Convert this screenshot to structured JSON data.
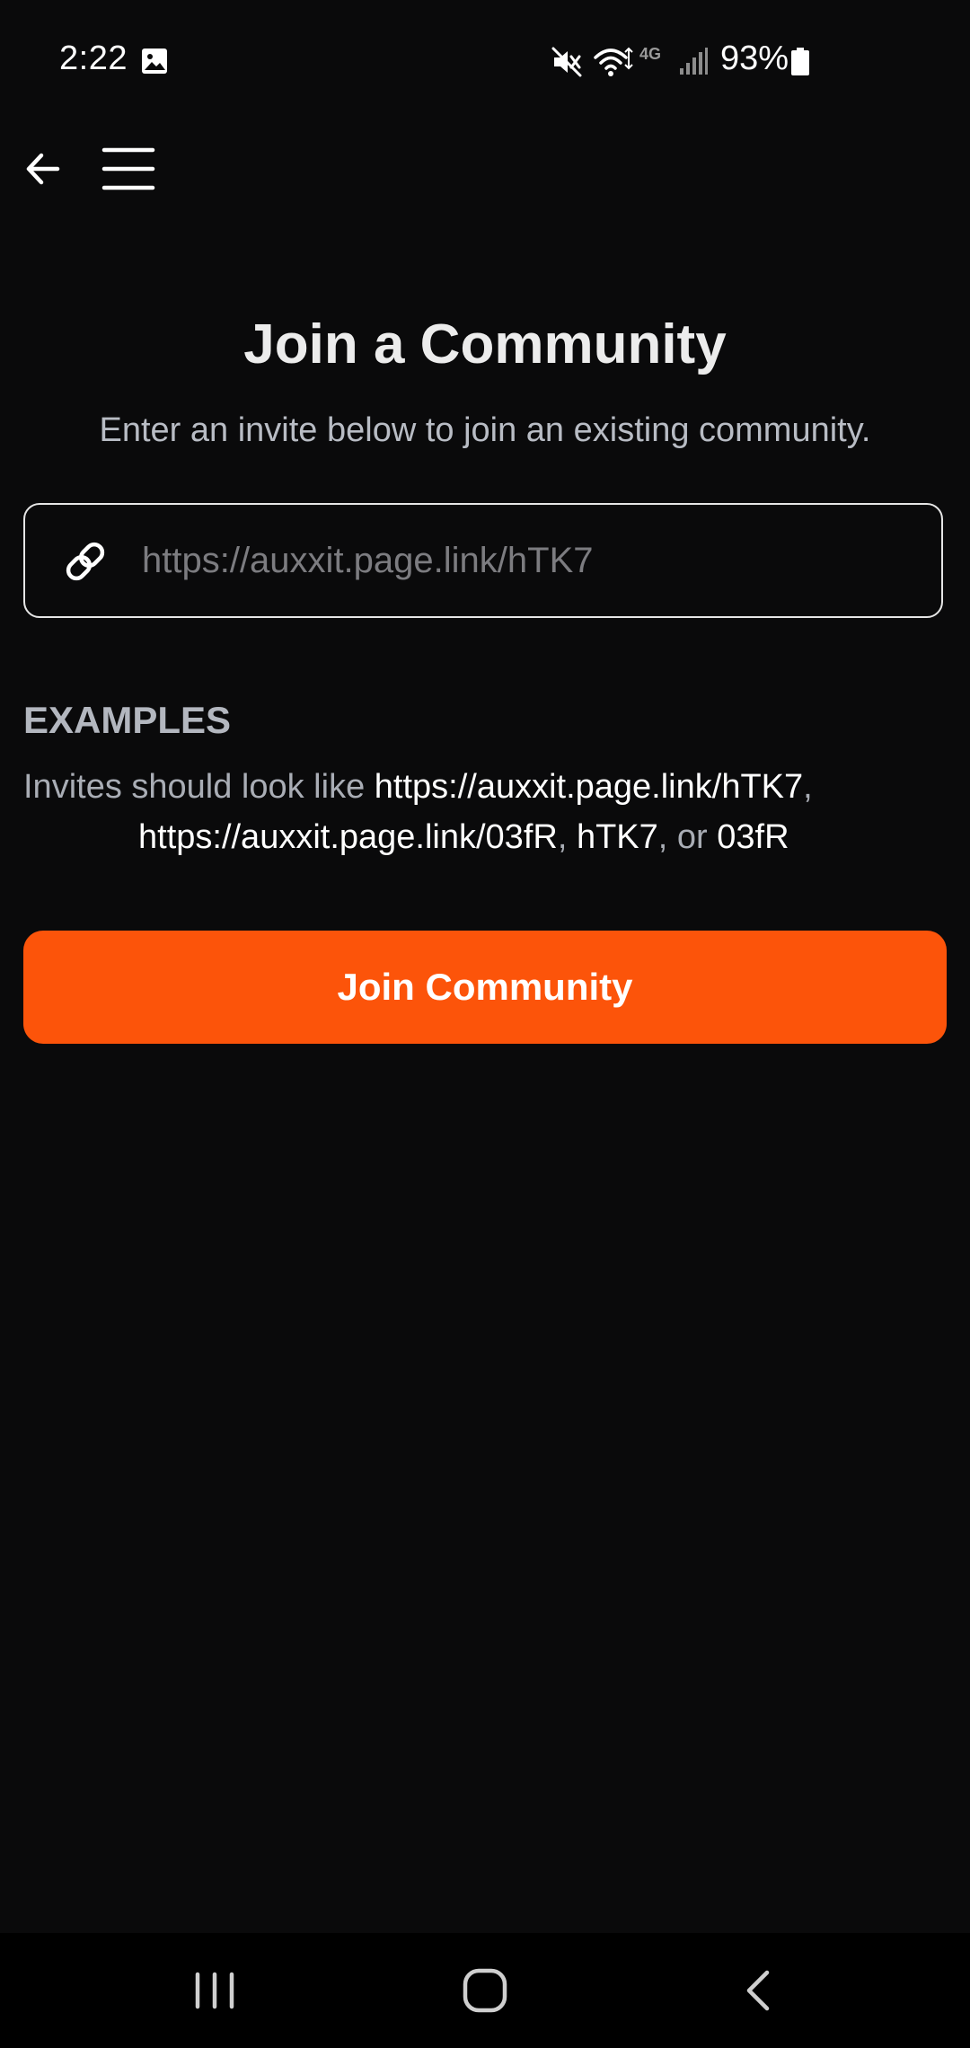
{
  "status_bar": {
    "time": "2:22",
    "battery_percent": "93%",
    "network_label": "4G",
    "icons": [
      "gallery-icon",
      "mute-icon",
      "wifi-icon",
      "signal-icon",
      "battery-icon"
    ]
  },
  "toolbar": {
    "icons": [
      "back-arrow-icon",
      "hamburger-menu-icon"
    ]
  },
  "page": {
    "title": "Join a Community",
    "subtitle": "Enter an invite below to join an existing community."
  },
  "invite": {
    "placeholder": "https://auxxit.page.link/hTK7",
    "value": "",
    "icon": "link-icon"
  },
  "examples": {
    "heading": "EXAMPLES",
    "intro": "Invites should look like ",
    "example_1": "https://auxxit.page.link/hTK7",
    "sep_1": ",",
    "example_2": "https://auxxit.page.link/03fR",
    "sep_2": ", ",
    "example_3": "hTK7",
    "sep_3": ", or ",
    "example_4": "03fR"
  },
  "join_button": {
    "label": "Join Community"
  },
  "colors": {
    "background": "#0a0a0b",
    "accent": "#fc540a",
    "text_primary": "#ececec",
    "text_secondary": "#a9adb5"
  },
  "system_nav": {
    "icons": [
      "recent-apps-icon",
      "home-icon",
      "system-back-icon"
    ]
  }
}
